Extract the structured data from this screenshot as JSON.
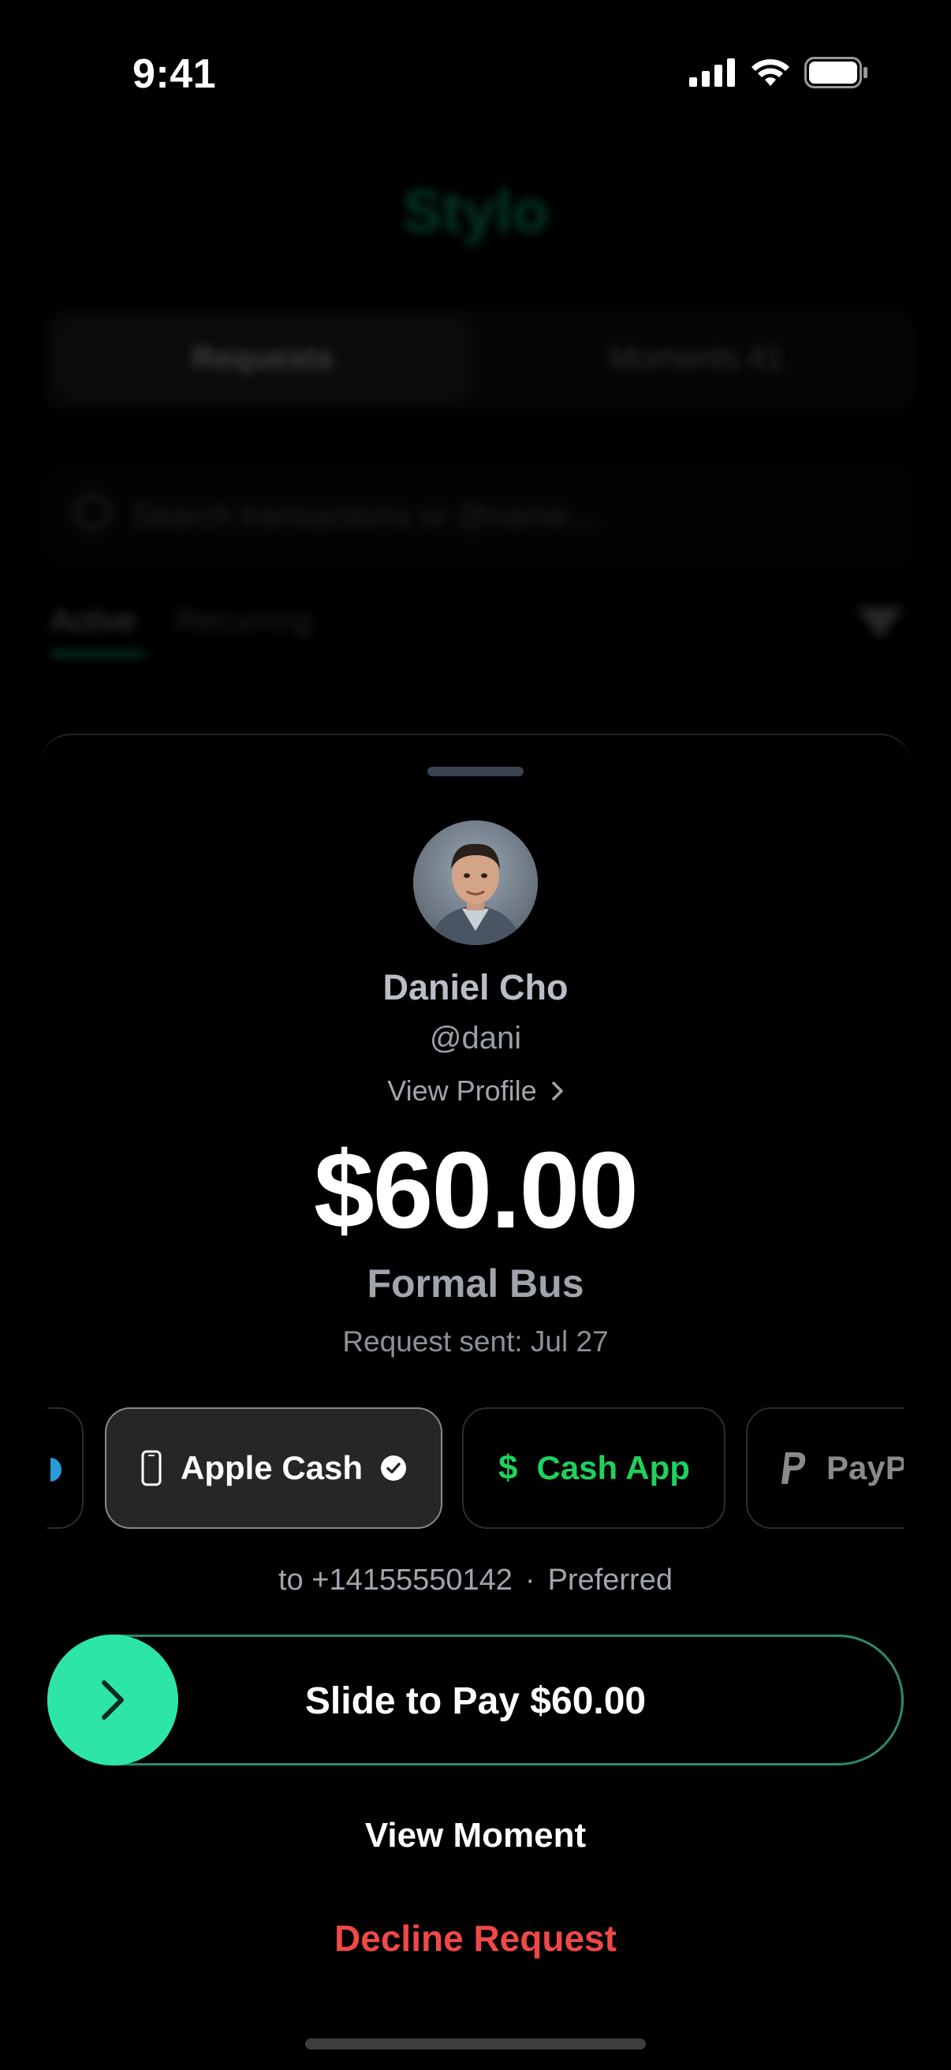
{
  "status_bar": {
    "time": "9:41"
  },
  "background": {
    "app_title": "Stylo",
    "segments": [
      "Requests",
      "Moments  41"
    ],
    "search_placeholder": "Search transactions or @name…",
    "tabs": [
      "Active",
      "Recurring"
    ],
    "partial_row": "Formal Bus"
  },
  "request": {
    "name": "Daniel Cho",
    "handle": "@dani",
    "view_profile": "View Profile",
    "amount": "$60.00",
    "memo": "Formal Bus",
    "sent": "Request sent: Jul 27"
  },
  "methods": [
    {
      "label": "Apple Cash",
      "icon": "phone-icon",
      "selected": true,
      "color": "#ffffff"
    },
    {
      "label": "Cash App",
      "icon": "dollar-icon",
      "selected": false,
      "color": "#1fd15d"
    },
    {
      "label": "PayP",
      "icon": "paypal-icon",
      "selected": false,
      "color": "#8a8a8a"
    }
  ],
  "destination": {
    "to": "to +14155550142",
    "separator": "·",
    "tag": "Preferred"
  },
  "slider": {
    "label": "Slide to Pay $60.00",
    "accent": "#2ee5a8"
  },
  "actions": {
    "view_moment": "View Moment",
    "decline": "Decline Request",
    "decline_color": "#f04848"
  }
}
